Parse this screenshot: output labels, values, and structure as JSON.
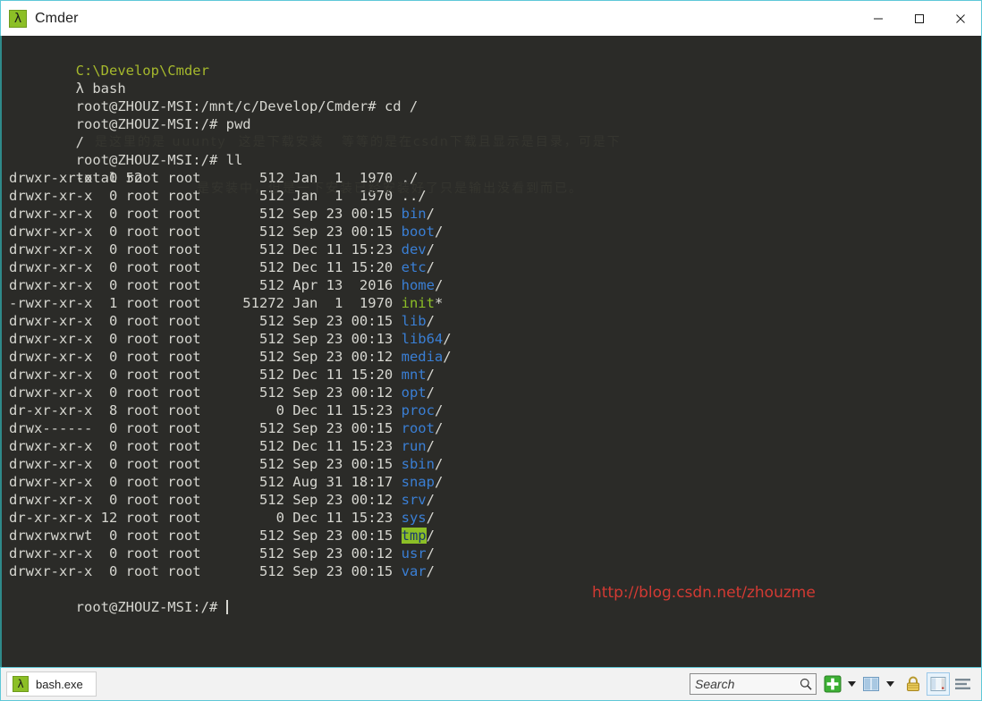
{
  "window": {
    "title": "Cmder",
    "icon": "lambda-icon",
    "icon_glyph": "λ",
    "controls": {
      "minimize": "minimize-button",
      "maximize": "maximize-button",
      "close": "close-button"
    }
  },
  "theme": {
    "terminal_bg": "#2b2b28",
    "terminal_fg": "#d6d6d0",
    "dir_color": "#3a7fd5",
    "exec_color": "#8cbf26",
    "path_color": "#a5b82c",
    "accent_border": "#5fc8d8",
    "watermark_color": "#d33a33"
  },
  "terminal": {
    "cwd_banner": "C:\\Develop\\Cmder",
    "shell_line_prompt": "λ",
    "shell_line_cmd": "bash",
    "commands": [
      {
        "prompt": "root@ZHOUZ-MSI:/mnt/c/Develop/Cmder# ",
        "cmd": "cd /"
      },
      {
        "prompt": "root@ZHOUZ-MSI:/# ",
        "cmd": "pwd"
      },
      {
        "prompt": "root@ZHOUZ-MSI:/# ",
        "cmd": "ll"
      }
    ],
    "pwd_output": "/",
    "total_line": "total 52",
    "final_prompt": "root@ZHOUZ-MSI:/# ",
    "listing": [
      {
        "perms": "drwxr-xr-x",
        "links": "0",
        "owner": "root",
        "group": "root",
        "size": "512",
        "month": "Jan",
        "day": "1",
        "time": "1970",
        "name": "./",
        "type": "plain"
      },
      {
        "perms": "drwxr-xr-x",
        "links": "0",
        "owner": "root",
        "group": "root",
        "size": "512",
        "month": "Jan",
        "day": "1",
        "time": "1970",
        "name": "../",
        "type": "plain"
      },
      {
        "perms": "drwxr-xr-x",
        "links": "0",
        "owner": "root",
        "group": "root",
        "size": "512",
        "month": "Sep",
        "day": "23",
        "time": "00:15",
        "name": "bin",
        "suffix": "/",
        "type": "dir"
      },
      {
        "perms": "drwxr-xr-x",
        "links": "0",
        "owner": "root",
        "group": "root",
        "size": "512",
        "month": "Sep",
        "day": "23",
        "time": "00:15",
        "name": "boot",
        "suffix": "/",
        "type": "dir"
      },
      {
        "perms": "drwxr-xr-x",
        "links": "0",
        "owner": "root",
        "group": "root",
        "size": "512",
        "month": "Dec",
        "day": "11",
        "time": "15:23",
        "name": "dev",
        "suffix": "/",
        "type": "dir"
      },
      {
        "perms": "drwxr-xr-x",
        "links": "0",
        "owner": "root",
        "group": "root",
        "size": "512",
        "month": "Dec",
        "day": "11",
        "time": "15:20",
        "name": "etc",
        "suffix": "/",
        "type": "dir"
      },
      {
        "perms": "drwxr-xr-x",
        "links": "0",
        "owner": "root",
        "group": "root",
        "size": "512",
        "month": "Apr",
        "day": "13",
        "time": "2016",
        "name": "home",
        "suffix": "/",
        "type": "dir"
      },
      {
        "perms": "-rwxr-xr-x",
        "links": "1",
        "owner": "root",
        "group": "root",
        "size": "51272",
        "month": "Jan",
        "day": "1",
        "time": "1970",
        "name": "init",
        "suffix": "*",
        "type": "exec"
      },
      {
        "perms": "drwxr-xr-x",
        "links": "0",
        "owner": "root",
        "group": "root",
        "size": "512",
        "month": "Sep",
        "day": "23",
        "time": "00:15",
        "name": "lib",
        "suffix": "/",
        "type": "dir"
      },
      {
        "perms": "drwxr-xr-x",
        "links": "0",
        "owner": "root",
        "group": "root",
        "size": "512",
        "month": "Sep",
        "day": "23",
        "time": "00:13",
        "name": "lib64",
        "suffix": "/",
        "type": "dir"
      },
      {
        "perms": "drwxr-xr-x",
        "links": "0",
        "owner": "root",
        "group": "root",
        "size": "512",
        "month": "Sep",
        "day": "23",
        "time": "00:12",
        "name": "media",
        "suffix": "/",
        "type": "dir"
      },
      {
        "perms": "drwxr-xr-x",
        "links": "0",
        "owner": "root",
        "group": "root",
        "size": "512",
        "month": "Dec",
        "day": "11",
        "time": "15:20",
        "name": "mnt",
        "suffix": "/",
        "type": "dir"
      },
      {
        "perms": "drwxr-xr-x",
        "links": "0",
        "owner": "root",
        "group": "root",
        "size": "512",
        "month": "Sep",
        "day": "23",
        "time": "00:12",
        "name": "opt",
        "suffix": "/",
        "type": "dir"
      },
      {
        "perms": "dr-xr-xr-x",
        "links": "8",
        "owner": "root",
        "group": "root",
        "size": "0",
        "month": "Dec",
        "day": "11",
        "time": "15:23",
        "name": "proc",
        "suffix": "/",
        "type": "dir"
      },
      {
        "perms": "drwx------",
        "links": "0",
        "owner": "root",
        "group": "root",
        "size": "512",
        "month": "Sep",
        "day": "23",
        "time": "00:15",
        "name": "root",
        "suffix": "/",
        "type": "dir"
      },
      {
        "perms": "drwxr-xr-x",
        "links": "0",
        "owner": "root",
        "group": "root",
        "size": "512",
        "month": "Dec",
        "day": "11",
        "time": "15:23",
        "name": "run",
        "suffix": "/",
        "type": "dir"
      },
      {
        "perms": "drwxr-xr-x",
        "links": "0",
        "owner": "root",
        "group": "root",
        "size": "512",
        "month": "Sep",
        "day": "23",
        "time": "00:15",
        "name": "sbin",
        "suffix": "/",
        "type": "dir"
      },
      {
        "perms": "drwxr-xr-x",
        "links": "0",
        "owner": "root",
        "group": "root",
        "size": "512",
        "month": "Aug",
        "day": "31",
        "time": "18:17",
        "name": "snap",
        "suffix": "/",
        "type": "dir"
      },
      {
        "perms": "drwxr-xr-x",
        "links": "0",
        "owner": "root",
        "group": "root",
        "size": "512",
        "month": "Sep",
        "day": "23",
        "time": "00:12",
        "name": "srv",
        "suffix": "/",
        "type": "dir"
      },
      {
        "perms": "dr-xr-xr-x",
        "links": "12",
        "owner": "root",
        "group": "root",
        "size": "0",
        "month": "Dec",
        "day": "11",
        "time": "15:23",
        "name": "sys",
        "suffix": "/",
        "type": "dir"
      },
      {
        "perms": "drwxrwxrwt",
        "links": "0",
        "owner": "root",
        "group": "root",
        "size": "512",
        "month": "Sep",
        "day": "23",
        "time": "00:15",
        "name": "tmp",
        "suffix": "/",
        "type": "sticky"
      },
      {
        "perms": "drwxr-xr-x",
        "links": "0",
        "owner": "root",
        "group": "root",
        "size": "512",
        "month": "Sep",
        "day": "23",
        "time": "00:12",
        "name": "usr",
        "suffix": "/",
        "type": "dir"
      },
      {
        "perms": "drwxr-xr-x",
        "links": "0",
        "owner": "root",
        "group": "root",
        "size": "512",
        "month": "Sep",
        "day": "23",
        "time": "00:15",
        "name": "var",
        "suffix": "/",
        "type": "dir"
      }
    ]
  },
  "watermarks": {
    "url": "http://blog.csdn.net/zhouzme",
    "bg_line1": "是这里的是 uuunty  这是下载安装   等等的是在csdn下载且显示是目录，可是下",
    "bg_line2": "是安装中，但是一下安装已经安装好了只是输出没看到而已。"
  },
  "statusbar": {
    "tab": {
      "label": "bash.exe",
      "icon": "lambda-icon",
      "icon_glyph": "λ"
    },
    "search": {
      "placeholder": "Search",
      "value": "",
      "icon": "magnifier-icon"
    },
    "buttons": [
      {
        "name": "new-console-button",
        "icon": "green-plus-icon"
      },
      {
        "name": "new-console-dropdown",
        "icon": "chevron-down-icon"
      },
      {
        "name": "split-pane-button",
        "icon": "split-pane-icon"
      },
      {
        "name": "split-pane-dropdown",
        "icon": "chevron-down-icon"
      },
      {
        "name": "lock-button",
        "icon": "lock-icon"
      },
      {
        "name": "window-list-button",
        "icon": "windows-icon"
      },
      {
        "name": "settings-button",
        "icon": "hamburger-icon"
      }
    ]
  }
}
